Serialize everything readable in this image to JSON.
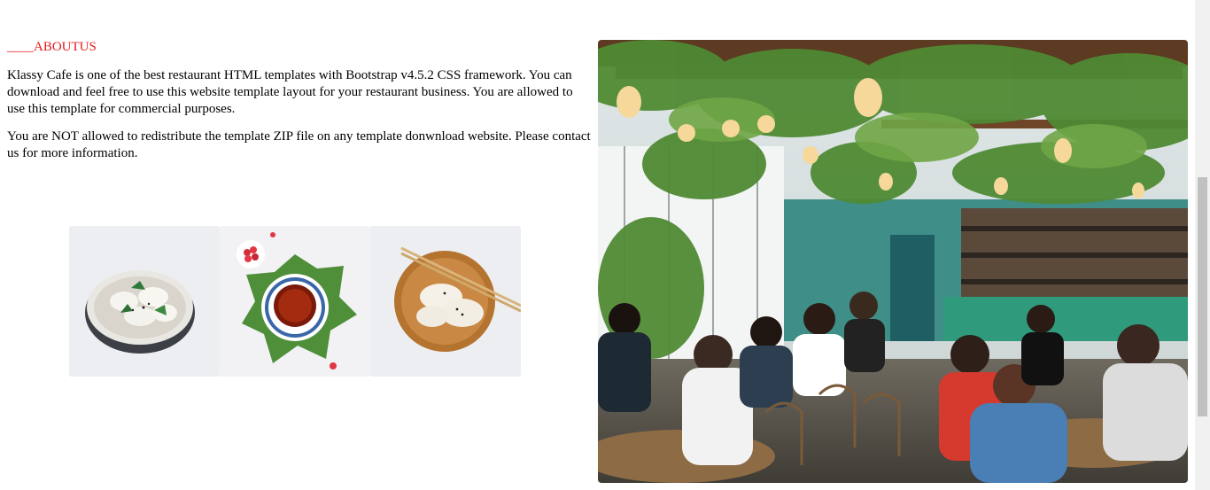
{
  "about": {
    "heading": "____ABOUTUS",
    "paragraph_1": "Klassy Cafe is one of the best restaurant HTML templates with Bootstrap v4.5.2 CSS framework. You can download and feel free to use this website template layout for your restaurant business. You are allowed to use this template for commercial purposes.",
    "paragraph_2": "You are NOT allowed to redistribute the template ZIP file on any template donwnload website. Please contact us for more information."
  },
  "colors": {
    "accent": "#e41b1b",
    "thumb_background": "#eef0f3",
    "scrollbar_track": "#f1f1f1",
    "scrollbar_thumb": "#c1c1c1"
  }
}
